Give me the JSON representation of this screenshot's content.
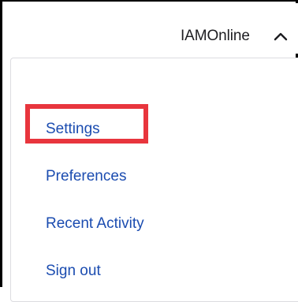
{
  "account_menu": {
    "user_name": "IAMOnline",
    "toggle_icon": "chevron-up-icon"
  },
  "menu": {
    "items": [
      {
        "label": "Settings"
      },
      {
        "label": "Preferences"
      },
      {
        "label": "Recent Activity"
      },
      {
        "label": "Sign out"
      }
    ]
  },
  "annotation": {
    "highlighted_item": "Settings",
    "highlight_color": "#e8353d"
  },
  "colors": {
    "link": "#1b4cb0",
    "text": "#1d1d21"
  }
}
